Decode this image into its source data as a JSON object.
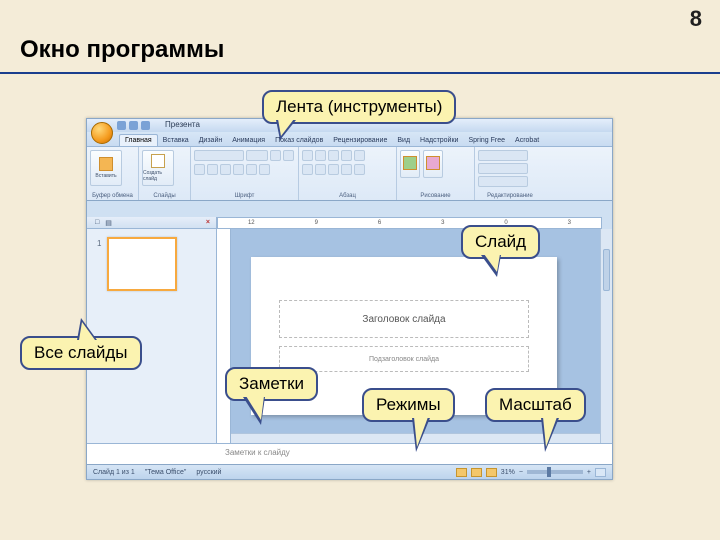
{
  "page": {
    "number": "8",
    "title": "Окно программы"
  },
  "app": {
    "title": "Презента",
    "tabs": [
      "Главная",
      "Вставка",
      "Дизайн",
      "Анимация",
      "Показ слайдов",
      "Рецензирование",
      "Вид",
      "Надстройки",
      "Spring Free",
      "Acrobat"
    ],
    "groups": {
      "clipboard": "Буфер обмена",
      "slides": "Слайды",
      "font": "Шрифт",
      "paragraph": "Абзац",
      "drawing": "Рисование",
      "editing": "Редактирование"
    },
    "group_buttons": {
      "paste": "Вставить",
      "new_slide": "Создать слайд"
    },
    "ruler_numbers": [
      "12",
      "9",
      "6",
      "3",
      "0",
      "3"
    ],
    "thumb_tabs": {
      "outline": "□",
      "slides": "▤"
    },
    "thumb_number": "1",
    "slide": {
      "title_placeholder": "Заголовок слайда",
      "subtitle_placeholder": "Подзаголовок слайда"
    },
    "notes_placeholder": "Заметки к слайду",
    "status": {
      "slide_info": "Слайд 1 из 1",
      "theme": "\"Тема Office\"",
      "lang": "русский",
      "zoom": "31%"
    }
  },
  "callouts": {
    "ribbon": "Лента (инструменты)",
    "slide": "Слайд",
    "thumbs": "Все слайды",
    "notes": "Заметки",
    "views": "Режимы",
    "zoom": "Масштаб"
  }
}
